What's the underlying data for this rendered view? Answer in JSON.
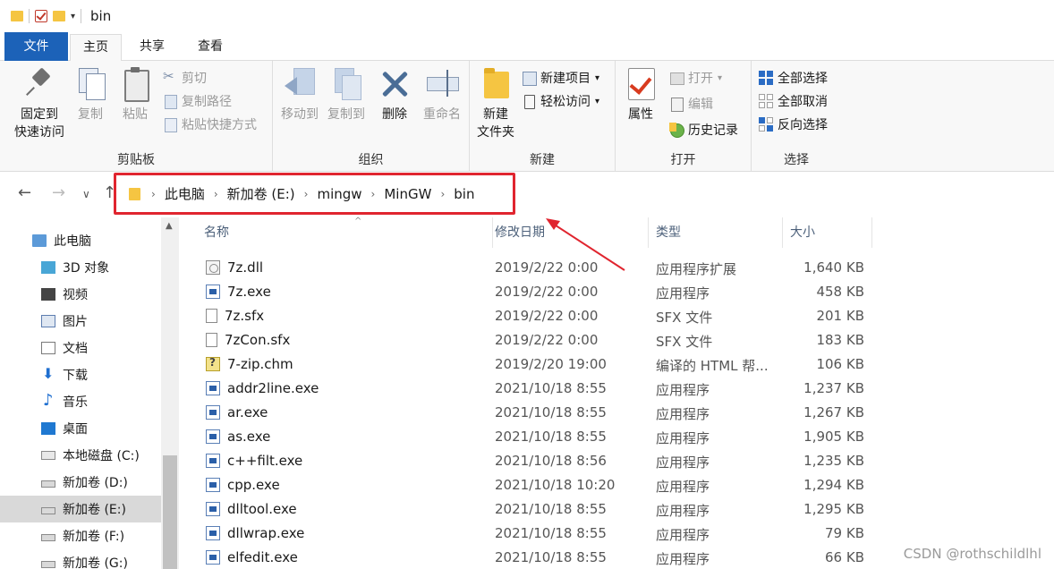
{
  "window": {
    "title": "bin"
  },
  "ribbon_tabs": {
    "file": "文件",
    "home": "主页",
    "share": "共享",
    "view": "查看"
  },
  "clipboard": {
    "pin_label": "固定到\n快速访问",
    "pin_line1": "固定到",
    "pin_line2": "快速访问",
    "copy": "复制",
    "paste": "粘贴",
    "cut": "剪切",
    "copy_path": "复制路径",
    "paste_shortcut": "粘贴快捷方式",
    "group_label": "剪贴板"
  },
  "organize": {
    "move_to": "移动到",
    "copy_to": "复制到",
    "delete": "删除",
    "rename": "重命名",
    "group_label": "组织"
  },
  "new": {
    "new_folder_line1": "新建",
    "new_folder_line2": "文件夹",
    "new_item": "新建项目",
    "easy_access": "轻松访问",
    "group_label": "新建"
  },
  "open": {
    "properties": "属性",
    "open": "打开",
    "edit": "编辑",
    "history": "历史记录",
    "group_label": "打开"
  },
  "select": {
    "select_all": "全部选择",
    "select_none": "全部取消",
    "invert": "反向选择",
    "group_label": "选择"
  },
  "breadcrumb": [
    "此电脑",
    "新加卷 (E:)",
    "mingw",
    "MinGW",
    "bin"
  ],
  "sidebar": {
    "items": [
      {
        "label": "此电脑",
        "icon": "computer-icon"
      },
      {
        "label": "3D 对象",
        "icon": "3d-objects-icon"
      },
      {
        "label": "视频",
        "icon": "video-icon"
      },
      {
        "label": "图片",
        "icon": "pictures-icon"
      },
      {
        "label": "文档",
        "icon": "documents-icon"
      },
      {
        "label": "下载",
        "icon": "download-icon"
      },
      {
        "label": "音乐",
        "icon": "music-icon"
      },
      {
        "label": "桌面",
        "icon": "desktop-icon"
      },
      {
        "label": "本地磁盘 (C:)",
        "icon": "system-drive-icon"
      },
      {
        "label": "新加卷 (D:)",
        "icon": "drive-icon"
      },
      {
        "label": "新加卷 (E:)",
        "icon": "drive-icon",
        "selected": true
      },
      {
        "label": "新加卷 (F:)",
        "icon": "drive-icon"
      },
      {
        "label": "新加卷 (G:)",
        "icon": "drive-icon"
      }
    ]
  },
  "columns": {
    "name": "名称",
    "date": "修改日期",
    "type": "类型",
    "size": "大小"
  },
  "files": [
    {
      "name": "7z.dll",
      "date": "2019/2/22 0:00",
      "type": "应用程序扩展",
      "size": "1,640 KB",
      "icon": "dll"
    },
    {
      "name": "7z.exe",
      "date": "2019/2/22 0:00",
      "type": "应用程序",
      "size": "458 KB",
      "icon": "exe"
    },
    {
      "name": "7z.sfx",
      "date": "2019/2/22 0:00",
      "type": "SFX 文件",
      "size": "201 KB",
      "icon": "blank"
    },
    {
      "name": "7zCon.sfx",
      "date": "2019/2/22 0:00",
      "type": "SFX 文件",
      "size": "183 KB",
      "icon": "blank"
    },
    {
      "name": "7-zip.chm",
      "date": "2019/2/20 19:00",
      "type": "编译的 HTML 帮...",
      "size": "106 KB",
      "icon": "chm"
    },
    {
      "name": "addr2line.exe",
      "date": "2021/10/18 8:55",
      "type": "应用程序",
      "size": "1,237 KB",
      "icon": "exe"
    },
    {
      "name": "ar.exe",
      "date": "2021/10/18 8:55",
      "type": "应用程序",
      "size": "1,267 KB",
      "icon": "exe"
    },
    {
      "name": "as.exe",
      "date": "2021/10/18 8:55",
      "type": "应用程序",
      "size": "1,905 KB",
      "icon": "exe"
    },
    {
      "name": "c++filt.exe",
      "date": "2021/10/18 8:56",
      "type": "应用程序",
      "size": "1,235 KB",
      "icon": "exe"
    },
    {
      "name": "cpp.exe",
      "date": "2021/10/18 10:20",
      "type": "应用程序",
      "size": "1,294 KB",
      "icon": "exe"
    },
    {
      "name": "dlltool.exe",
      "date": "2021/10/18 8:55",
      "type": "应用程序",
      "size": "1,295 KB",
      "icon": "exe"
    },
    {
      "name": "dllwrap.exe",
      "date": "2021/10/18 8:55",
      "type": "应用程序",
      "size": "79 KB",
      "icon": "exe"
    },
    {
      "name": "elfedit.exe",
      "date": "2021/10/18 8:55",
      "type": "应用程序",
      "size": "66 KB",
      "icon": "exe"
    }
  ],
  "watermark": "CSDN @rothschildlhl",
  "colors": {
    "file_tab": "#1c62b8",
    "highlight_box": "#e0252f",
    "selected_row": "#d9d9d9"
  }
}
